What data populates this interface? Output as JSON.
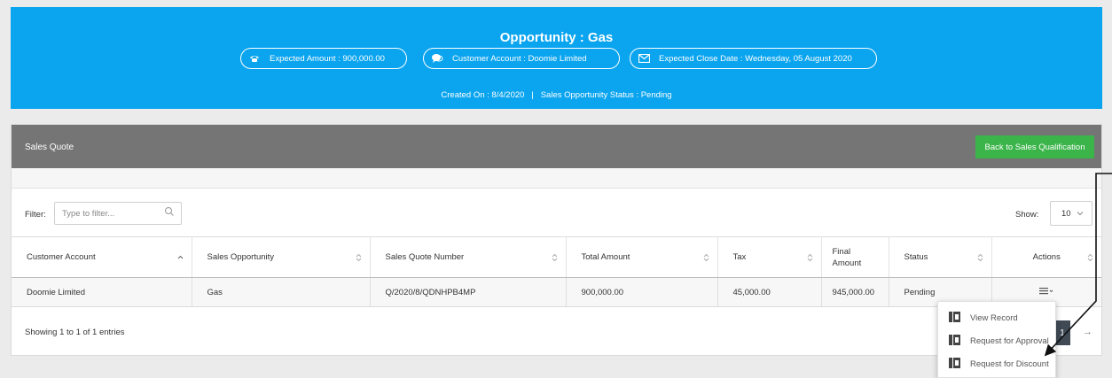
{
  "banner": {
    "title": "Opportunity : Gas",
    "expected_amount": "Expected Amount : 900,000.00",
    "customer_account": "Customer Account : Doomie Limited",
    "expected_close_date": "Expected Close Date : Wednesday, 05 August 2020",
    "meta": "Created On : 8/4/2020   |   Sales Opportunity Status : Pending"
  },
  "card": {
    "title": "Sales Quote",
    "back_button": "Back to Sales Qualification"
  },
  "filter": {
    "label": "Filter:",
    "placeholder": "Type to filter..."
  },
  "show": {
    "label": "Show:",
    "value": "10"
  },
  "table": {
    "headers": [
      "Customer Account",
      "Sales Opportunity",
      "Sales Quote Number",
      "Total Amount",
      "Tax",
      "Final Amount",
      "Status",
      "Actions"
    ],
    "rows": [
      [
        "Doomie Limited",
        "Gas",
        "Q/2020/8/QDNHPB4MP",
        "900,000.00",
        "45,000.00",
        "945,000.00",
        "Pending"
      ]
    ]
  },
  "footer": {
    "info": "Showing 1 to 1 of 1 entries",
    "page": "1",
    "next": "→"
  },
  "menu": {
    "items": [
      "View Record",
      "Request for Approval",
      "Request for Discount"
    ]
  },
  "colors": {
    "banner": "#0aa4ef",
    "header_bar": "#757575",
    "button_green": "#3bb44a",
    "page_active": "#3f4a55"
  }
}
